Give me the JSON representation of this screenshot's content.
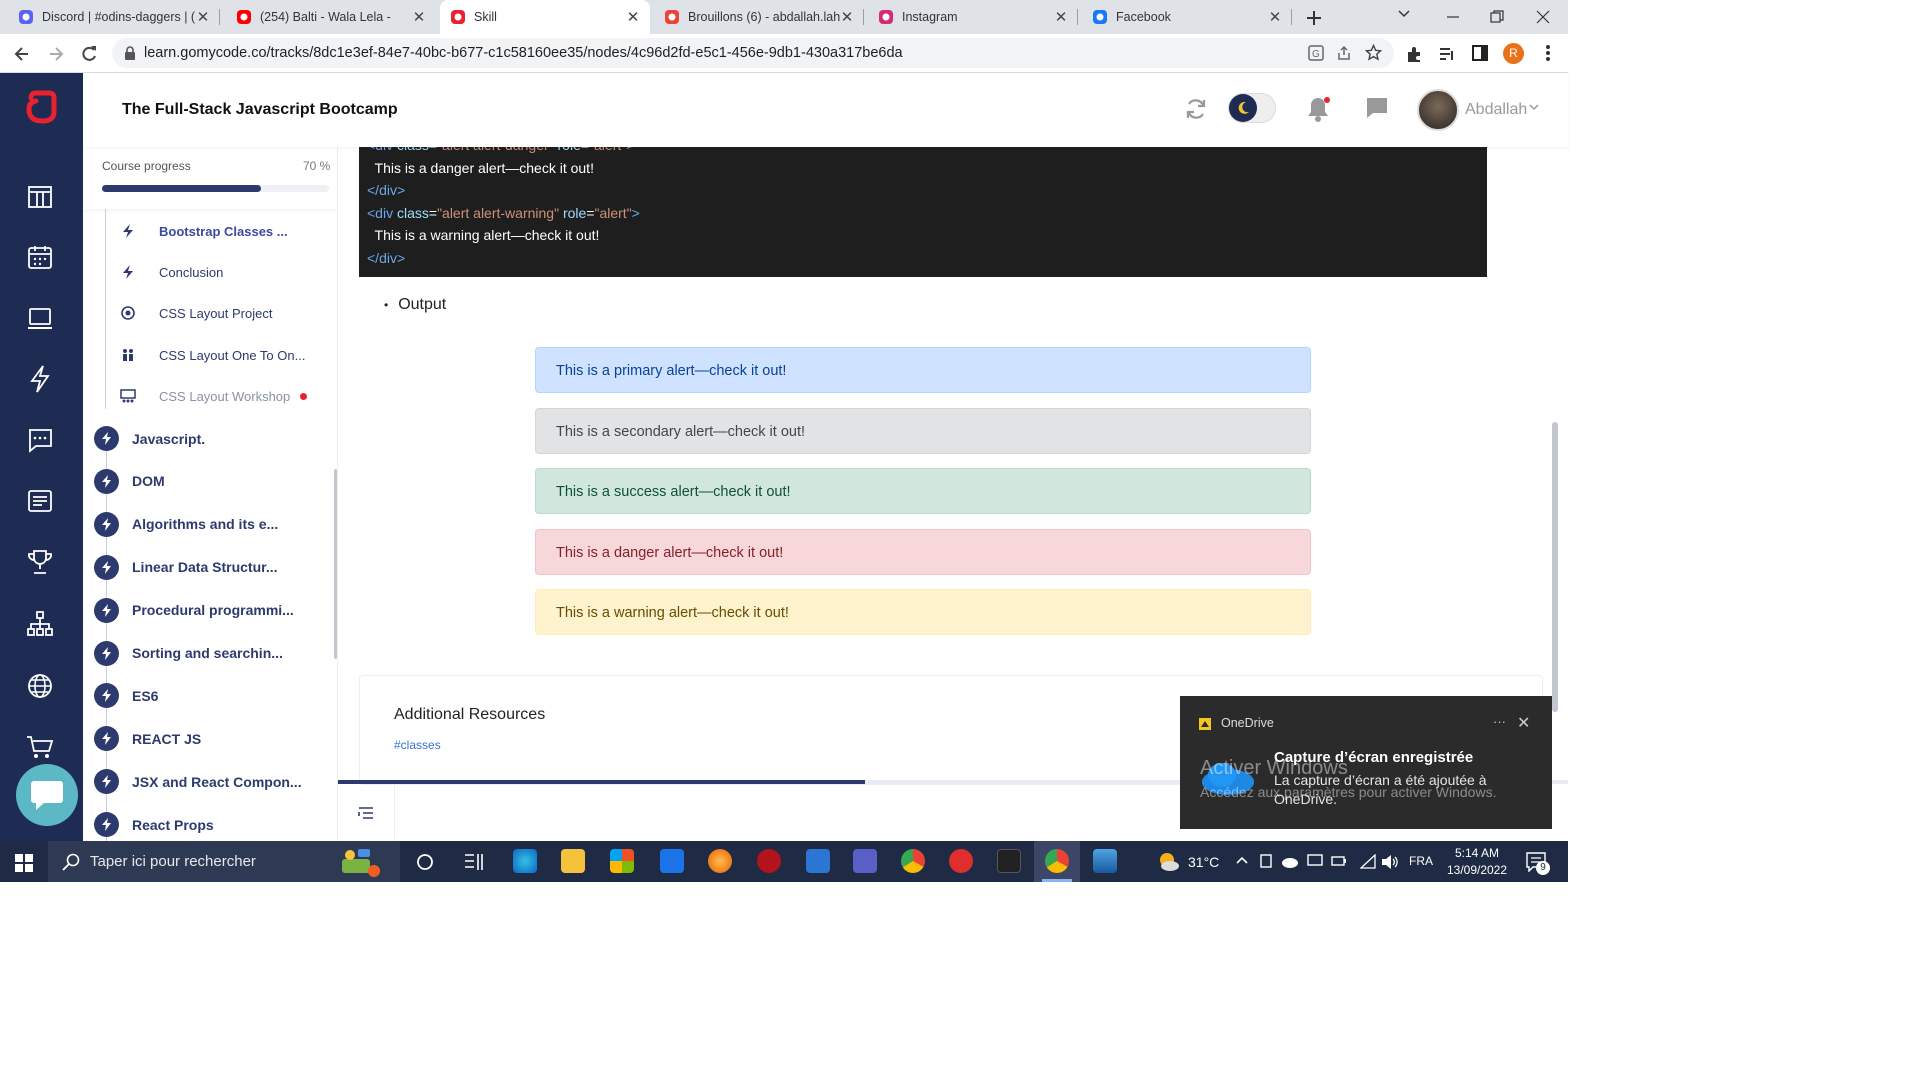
{
  "browser": {
    "tabs": [
      {
        "title": "Discord | #odins-daggers | (",
        "icon": "discord-icon",
        "color": "#5865f2"
      },
      {
        "title": "(254) Balti - Wala Lela -",
        "icon": "youtube-icon",
        "color": "#ff0000"
      },
      {
        "title": "Skill",
        "icon": "gomycode-icon",
        "color": "#e8232f",
        "active": true
      },
      {
        "title": "Brouillons (6) - abdallah.lah",
        "icon": "gmail-icon",
        "color": "#ea4335"
      },
      {
        "title": "Instagram",
        "icon": "instagram-icon",
        "color": "#d62976"
      },
      {
        "title": "Facebook",
        "icon": "facebook-icon",
        "color": "#1877f2"
      }
    ],
    "url": "learn.gomycode.co/tracks/8dc1e3ef-84e7-40bc-b677-c1c58160ee35/nodes/4c96d2fd-e5c1-456e-9db1-430a317be6da",
    "profile_initial": "R"
  },
  "header": {
    "title": "The Full-Stack Javascript Bootcamp",
    "user_name": "Abdallah"
  },
  "progress": {
    "label": "Course progress",
    "value_text": "70 %",
    "value": 0.7
  },
  "sub_items": [
    {
      "label": "Bootstrap Classes ...",
      "icon": "bolt-icon",
      "active": true
    },
    {
      "label": "Conclusion",
      "icon": "bolt-icon"
    },
    {
      "label": "CSS Layout Project",
      "icon": "target-icon"
    },
    {
      "label": "CSS Layout One To On...",
      "icon": "people-icon"
    },
    {
      "label": "CSS Layout Workshop",
      "icon": "workshop-icon",
      "muted": true,
      "dot": true
    }
  ],
  "modules": [
    "Javascript.",
    "DOM",
    "Algorithms and its e...",
    "Linear Data Structur...",
    "Procedural programmi...",
    "Sorting and searchin...",
    "ES6",
    "REACT JS",
    "JSX and React Compon...",
    "React Props"
  ],
  "code_lines": [
    [
      {
        "t": "<div ",
        "c": "tag"
      },
      {
        "t": "class",
        "c": "attr"
      },
      {
        "t": "=",
        "c": "txt"
      },
      {
        "t": "\"alert alert-danger\"",
        "c": "str"
      },
      {
        "t": " role",
        "c": "attr"
      },
      {
        "t": "=",
        "c": "txt"
      },
      {
        "t": "\"alert\"",
        "c": "str"
      },
      {
        "t": ">",
        "c": "tag"
      }
    ],
    [
      {
        "t": "  This is a danger alert—check it out!",
        "c": "txt"
      }
    ],
    [
      {
        "t": "</div>",
        "c": "tag"
      }
    ],
    [
      {
        "t": "<div ",
        "c": "tag"
      },
      {
        "t": "class",
        "c": "attr"
      },
      {
        "t": "=",
        "c": "txt"
      },
      {
        "t": "\"alert alert-warning\"",
        "c": "str"
      },
      {
        "t": " role",
        "c": "attr"
      },
      {
        "t": "=",
        "c": "txt"
      },
      {
        "t": "\"alert\"",
        "c": "str"
      },
      {
        "t": ">",
        "c": "tag"
      }
    ],
    [
      {
        "t": "  This is a warning alert—check it out!",
        "c": "txt"
      }
    ],
    [
      {
        "t": "</div>",
        "c": "tag"
      }
    ]
  ],
  "output_label": "Output",
  "alerts": [
    {
      "text": "This is a primary alert—check it out!",
      "bg": "#cfe2ff",
      "border": "#b6d4fe",
      "color": "#084298"
    },
    {
      "text": "This is a secondary alert—check it out!",
      "bg": "#e2e3e5",
      "border": "#d3d6d8",
      "color": "#41464b"
    },
    {
      "text": "This is a success alert—check it out!",
      "bg": "#d1e7dd",
      "border": "#badbcc",
      "color": "#0f5132"
    },
    {
      "text": "This is a danger alert—check it out!",
      "bg": "#f8d7da",
      "border": "#f5c2c7",
      "color": "#842029"
    },
    {
      "text": "This is a warning alert—check it out!",
      "bg": "#fff3cd",
      "border": "#ffecb5",
      "color": "#664d03"
    }
  ],
  "resources": {
    "title": "Additional Resources",
    "tag": "#classes"
  },
  "toast": {
    "app": "OneDrive",
    "title": "Capture d’écran enregistrée",
    "body": "La capture d’écran a été ajoutée à OneDrive.",
    "watermark_title": "Activer Windows",
    "watermark_body": "Accédez aux paramètres pour activer Windows."
  },
  "taskbar": {
    "search_placeholder": "Taper ici pour rechercher",
    "weather": "31°C",
    "lang": "FRA",
    "time": "5:14 AM",
    "date": "13/09/2022",
    "notif_count": "9"
  },
  "colors": {
    "brand": "#e8232f",
    "navy": "#2d3a6e",
    "rail": "#1e2b52"
  }
}
